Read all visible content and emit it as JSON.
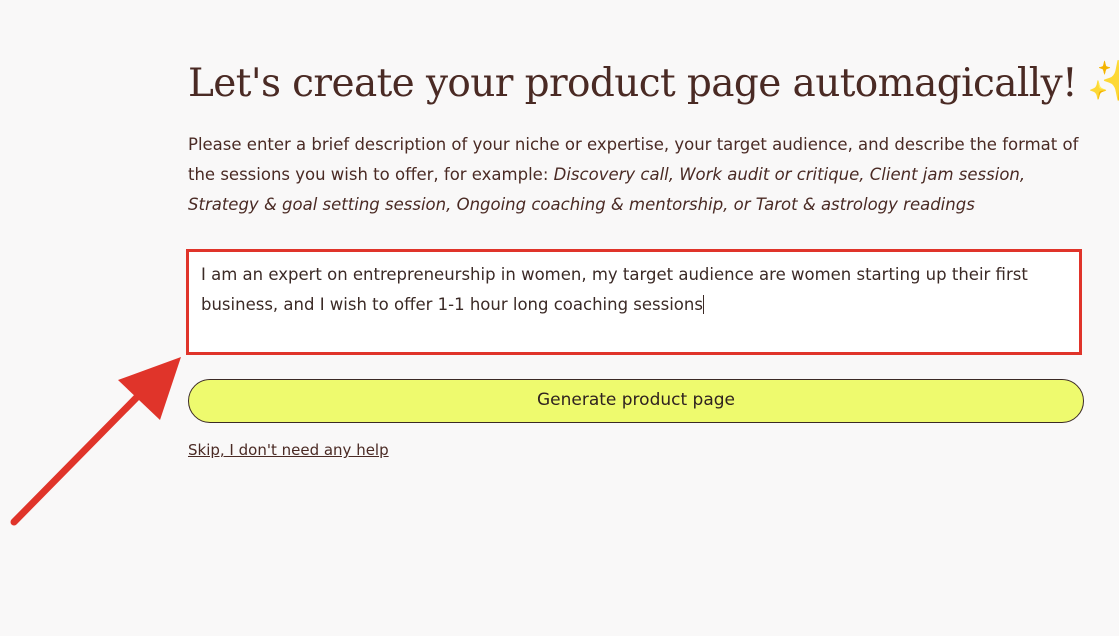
{
  "header": {
    "title": "Let's create your product page automagically!",
    "title_emoji": "✨"
  },
  "description": {
    "intro": "Please enter a brief description of your niche or expertise, your target audience, and describe the format of the sessions you wish to offer, for example: ",
    "examples": "Discovery call, Work audit or critique, Client jam session, Strategy & goal setting session, Ongoing coaching & mentorship, or Tarot & astrology readings"
  },
  "input": {
    "value": "I am an expert on entrepreneurship in women, my target audience are women starting up their first business, and I wish to offer 1-1 hour long coaching sessions"
  },
  "actions": {
    "generate_label": "Generate product page",
    "skip_label": "Skip, I don't need any help"
  },
  "colors": {
    "background": "#f9f8f8",
    "text": "#4a2a24",
    "button_fill": "#eefa6e",
    "highlight": "#e0342a"
  }
}
